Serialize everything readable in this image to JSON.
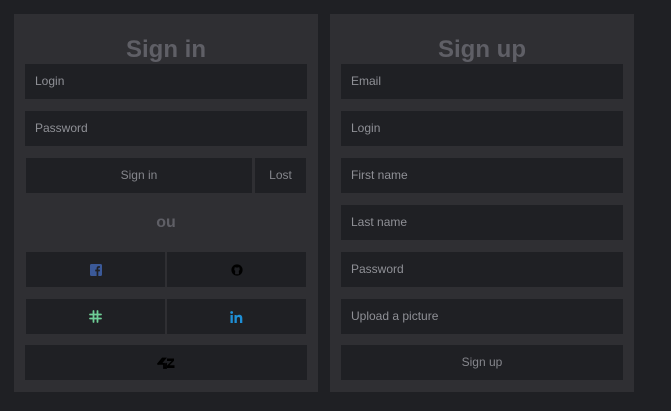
{
  "signin": {
    "title": "Sign in",
    "login_placeholder": "Login",
    "password_placeholder": "Password",
    "submit_label": "Sign in",
    "lost_label": "Lost",
    "separator": "ou",
    "providers": [
      {
        "name": "facebook",
        "icon": "facebook-icon",
        "color": "#3b5998"
      },
      {
        "name": "github",
        "icon": "github-icon",
        "color": "#000000"
      },
      {
        "name": "slack",
        "icon": "slack-icon",
        "color": "#6fcf97"
      },
      {
        "name": "linkedin",
        "icon": "linkedin-icon",
        "color": "#1e8fd6"
      },
      {
        "name": "42",
        "icon": "42-icon",
        "color": "#000000"
      }
    ]
  },
  "signup": {
    "title": "Sign up",
    "email_placeholder": "Email",
    "login_placeholder": "Login",
    "firstname_placeholder": "First name",
    "lastname_placeholder": "Last name",
    "password_placeholder": "Password",
    "upload_label": "Upload a picture",
    "submit_label": "Sign up"
  },
  "colors": {
    "page_bg": "#1f2024",
    "panel_bg": "#2f2f33",
    "field_bg": "#1f2024",
    "title": "#5f5f66",
    "text": "#8f9096"
  }
}
